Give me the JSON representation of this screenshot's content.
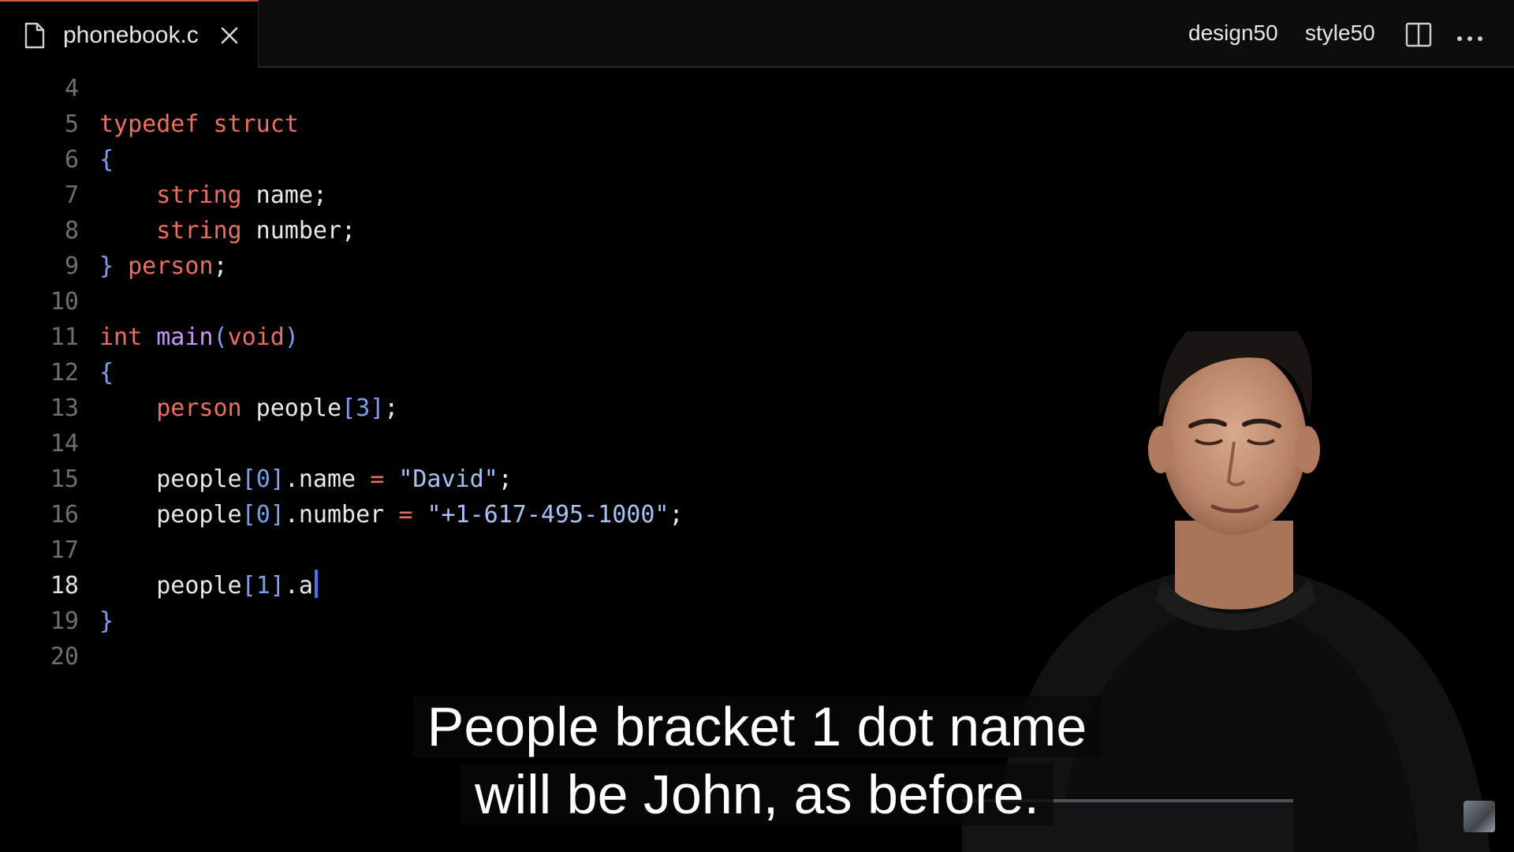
{
  "tab": {
    "filename": "phonebook.c"
  },
  "toolbar": {
    "design_label": "design50",
    "style_label": "style50"
  },
  "editor": {
    "active_line": "18",
    "lines": [
      {
        "num": "4",
        "tokens": []
      },
      {
        "num": "5",
        "tokens": [
          {
            "t": "typedef struct",
            "c": "kw"
          }
        ]
      },
      {
        "num": "6",
        "tokens": [
          {
            "t": "{",
            "c": "pun"
          }
        ]
      },
      {
        "num": "7",
        "tokens": [
          {
            "t": "    ",
            "c": "plain"
          },
          {
            "t": "string",
            "c": "kw"
          },
          {
            "t": " name;",
            "c": "plain"
          }
        ]
      },
      {
        "num": "8",
        "tokens": [
          {
            "t": "    ",
            "c": "plain"
          },
          {
            "t": "string",
            "c": "kw"
          },
          {
            "t": " number;",
            "c": "plain"
          }
        ]
      },
      {
        "num": "9",
        "tokens": [
          {
            "t": "}",
            "c": "pun"
          },
          {
            "t": " ",
            "c": "plain"
          },
          {
            "t": "person",
            "c": "kw"
          },
          {
            "t": ";",
            "c": "plain"
          }
        ]
      },
      {
        "num": "10",
        "tokens": []
      },
      {
        "num": "11",
        "tokens": [
          {
            "t": "int",
            "c": "kw"
          },
          {
            "t": " ",
            "c": "plain"
          },
          {
            "t": "main",
            "c": "fn"
          },
          {
            "t": "(",
            "c": "pun"
          },
          {
            "t": "void",
            "c": "kw"
          },
          {
            "t": ")",
            "c": "pun"
          }
        ]
      },
      {
        "num": "12",
        "tokens": [
          {
            "t": "{",
            "c": "pun"
          }
        ]
      },
      {
        "num": "13",
        "tokens": [
          {
            "t": "    ",
            "c": "plain"
          },
          {
            "t": "person",
            "c": "kw"
          },
          {
            "t": " people",
            "c": "plain"
          },
          {
            "t": "[",
            "c": "pun"
          },
          {
            "t": "3",
            "c": "num"
          },
          {
            "t": "]",
            "c": "pun"
          },
          {
            "t": ";",
            "c": "plain"
          }
        ]
      },
      {
        "num": "14",
        "tokens": []
      },
      {
        "num": "15",
        "tokens": [
          {
            "t": "    people",
            "c": "plain"
          },
          {
            "t": "[",
            "c": "pun"
          },
          {
            "t": "0",
            "c": "num"
          },
          {
            "t": "]",
            "c": "pun"
          },
          {
            "t": ".name ",
            "c": "plain"
          },
          {
            "t": "=",
            "c": "kw"
          },
          {
            "t": " ",
            "c": "plain"
          },
          {
            "t": "\"David\"",
            "c": "str"
          },
          {
            "t": ";",
            "c": "plain"
          }
        ]
      },
      {
        "num": "16",
        "tokens": [
          {
            "t": "    people",
            "c": "plain"
          },
          {
            "t": "[",
            "c": "pun"
          },
          {
            "t": "0",
            "c": "num"
          },
          {
            "t": "]",
            "c": "pun"
          },
          {
            "t": ".number ",
            "c": "plain"
          },
          {
            "t": "=",
            "c": "kw"
          },
          {
            "t": " ",
            "c": "plain"
          },
          {
            "t": "\"+1-617-495-1000\"",
            "c": "str"
          },
          {
            "t": ";",
            "c": "plain"
          }
        ]
      },
      {
        "num": "17",
        "tokens": []
      },
      {
        "num": "18",
        "tokens": [
          {
            "t": "    people",
            "c": "plain"
          },
          {
            "t": "[",
            "c": "pun"
          },
          {
            "t": "1",
            "c": "num"
          },
          {
            "t": "]",
            "c": "pun"
          },
          {
            "t": ".a",
            "c": "plain"
          }
        ]
      },
      {
        "num": "19",
        "tokens": [
          {
            "t": "}",
            "c": "pun"
          }
        ]
      },
      {
        "num": "20",
        "tokens": []
      }
    ]
  },
  "captions": {
    "line1": "People bracket 1 dot name",
    "line2": "will be John, as before."
  },
  "colors": {
    "tab_accent": "#d4553d",
    "keyword": "#ec6e5f",
    "function": "#c39af7",
    "punctuation": "#7f9ff2",
    "string": "#a7c1f7",
    "cursor": "#3f75ff"
  }
}
